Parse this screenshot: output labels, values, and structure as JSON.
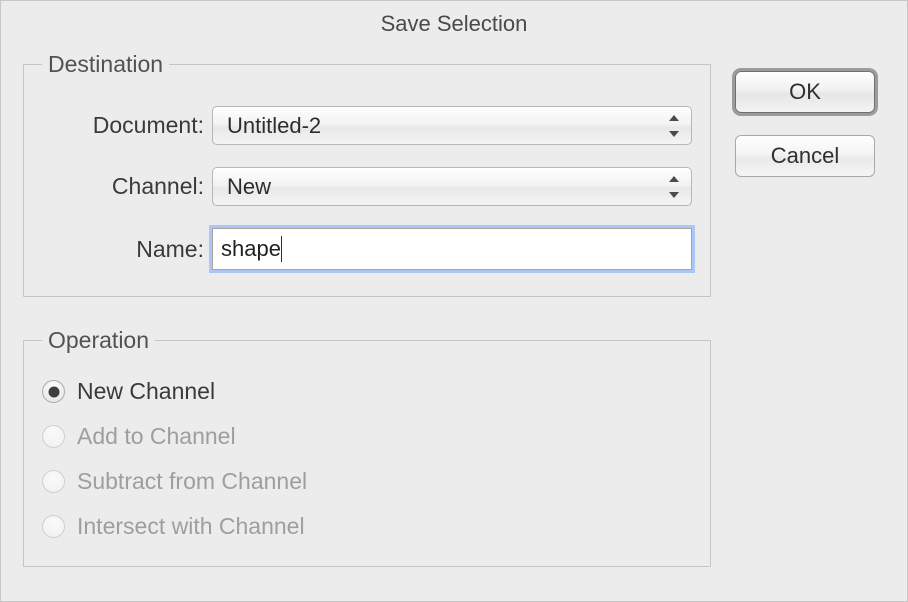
{
  "dialog": {
    "title": "Save Selection"
  },
  "buttons": {
    "ok": "OK",
    "cancel": "Cancel"
  },
  "destination": {
    "legend": "Destination",
    "document_label": "Document:",
    "document_value": "Untitled-2",
    "channel_label": "Channel:",
    "channel_value": "New",
    "name_label": "Name:",
    "name_value": "shape"
  },
  "operation": {
    "legend": "Operation",
    "options": {
      "new_channel": "New Channel",
      "add_to_channel": "Add to Channel",
      "subtract_from_channel": "Subtract from Channel",
      "intersect_with_channel": "Intersect with Channel"
    },
    "selected": "new_channel"
  }
}
